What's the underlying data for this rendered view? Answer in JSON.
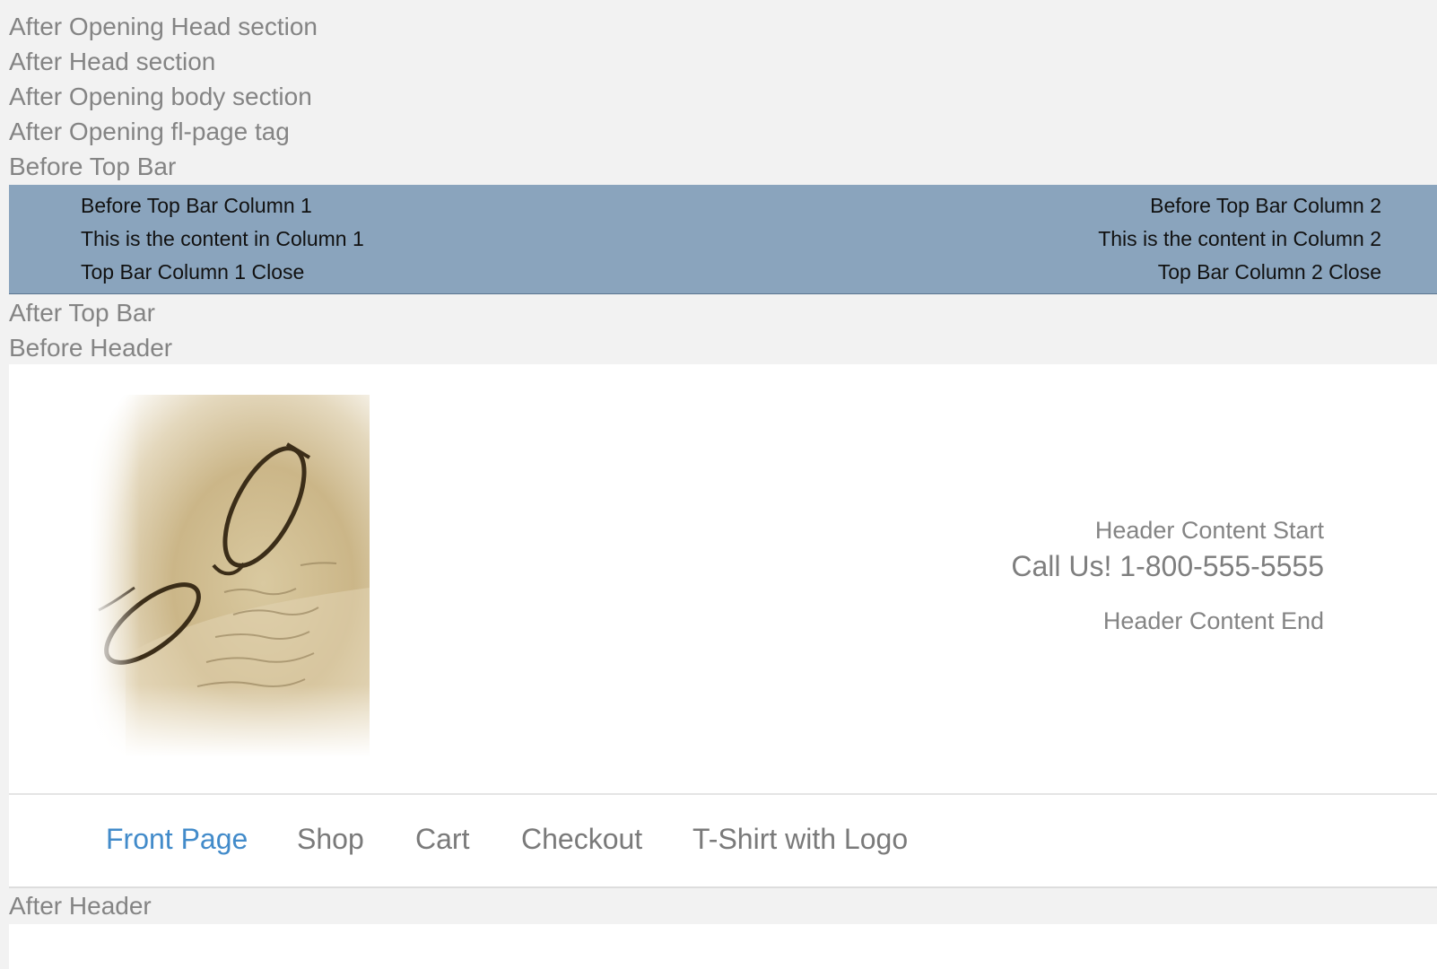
{
  "hooks": {
    "after_opening_head": "After Opening Head section",
    "after_head": "After Head section",
    "after_opening_body": "After Opening body section",
    "after_opening_fl_page": "After Opening fl-page tag",
    "before_top_bar": "Before Top Bar",
    "after_top_bar": "After Top Bar",
    "before_header": "Before Header",
    "after_header": "After Header"
  },
  "top_bar": {
    "background": "#8aa4bd",
    "column1": {
      "before": "Before Top Bar Column 1",
      "content": "This is the content in Column 1",
      "close": "Top Bar Column 1 Close"
    },
    "column2": {
      "before": "Before Top Bar Column 2",
      "content": "This is the content in Column 2",
      "close": "Top Bar Column 2 Close"
    }
  },
  "header": {
    "logo_icon": "reading-glasses-on-letter-image",
    "content_start": "Header Content Start",
    "call_us": "Call Us! 1-800-555-5555",
    "content_end": "Header Content End"
  },
  "nav": {
    "accent": "#428bca",
    "items": [
      {
        "label": "Front Page",
        "active": true
      },
      {
        "label": "Shop",
        "active": false
      },
      {
        "label": "Cart",
        "active": false
      },
      {
        "label": "Checkout",
        "active": false
      },
      {
        "label": "T-Shirt with Logo",
        "active": false
      }
    ]
  }
}
